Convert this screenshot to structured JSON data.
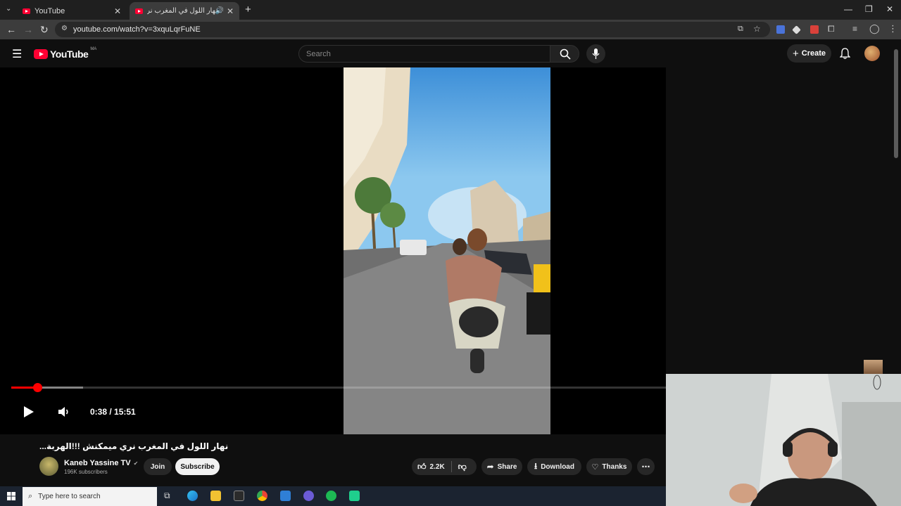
{
  "browser": {
    "tabs": [
      {
        "label": "YouTube",
        "active": false
      },
      {
        "label": "نهار اللول في المغرب نري ميه",
        "active": true
      }
    ],
    "new_tab": "+",
    "url": "youtube.com/watch?v=3xquLqrFuNE"
  },
  "youtube": {
    "logo_text": "YouTube",
    "region": "MA",
    "search_placeholder": "Search",
    "create_label": "Create"
  },
  "player": {
    "time_display": "0:38 / 15:51",
    "progress_fraction": 0.04,
    "buffer_fraction": 0.11
  },
  "video_info": {
    "title": "نهار اللول في المغرب نري ميمكنش !!!الهربة...",
    "channel": "Kaneb Yassine TV",
    "subscribers": "196K subscribers",
    "join_label": "Join",
    "subscribe_label": "Subscribe",
    "likes": "2.2K",
    "share_label": "Share",
    "download_label": "Download",
    "thanks_label": "Thanks"
  },
  "taskbar": {
    "search_placeholder": "Type here to search"
  },
  "colors": {
    "brand_red": "#ff0033",
    "background": "#0f0f0f",
    "pill": "#272727"
  }
}
